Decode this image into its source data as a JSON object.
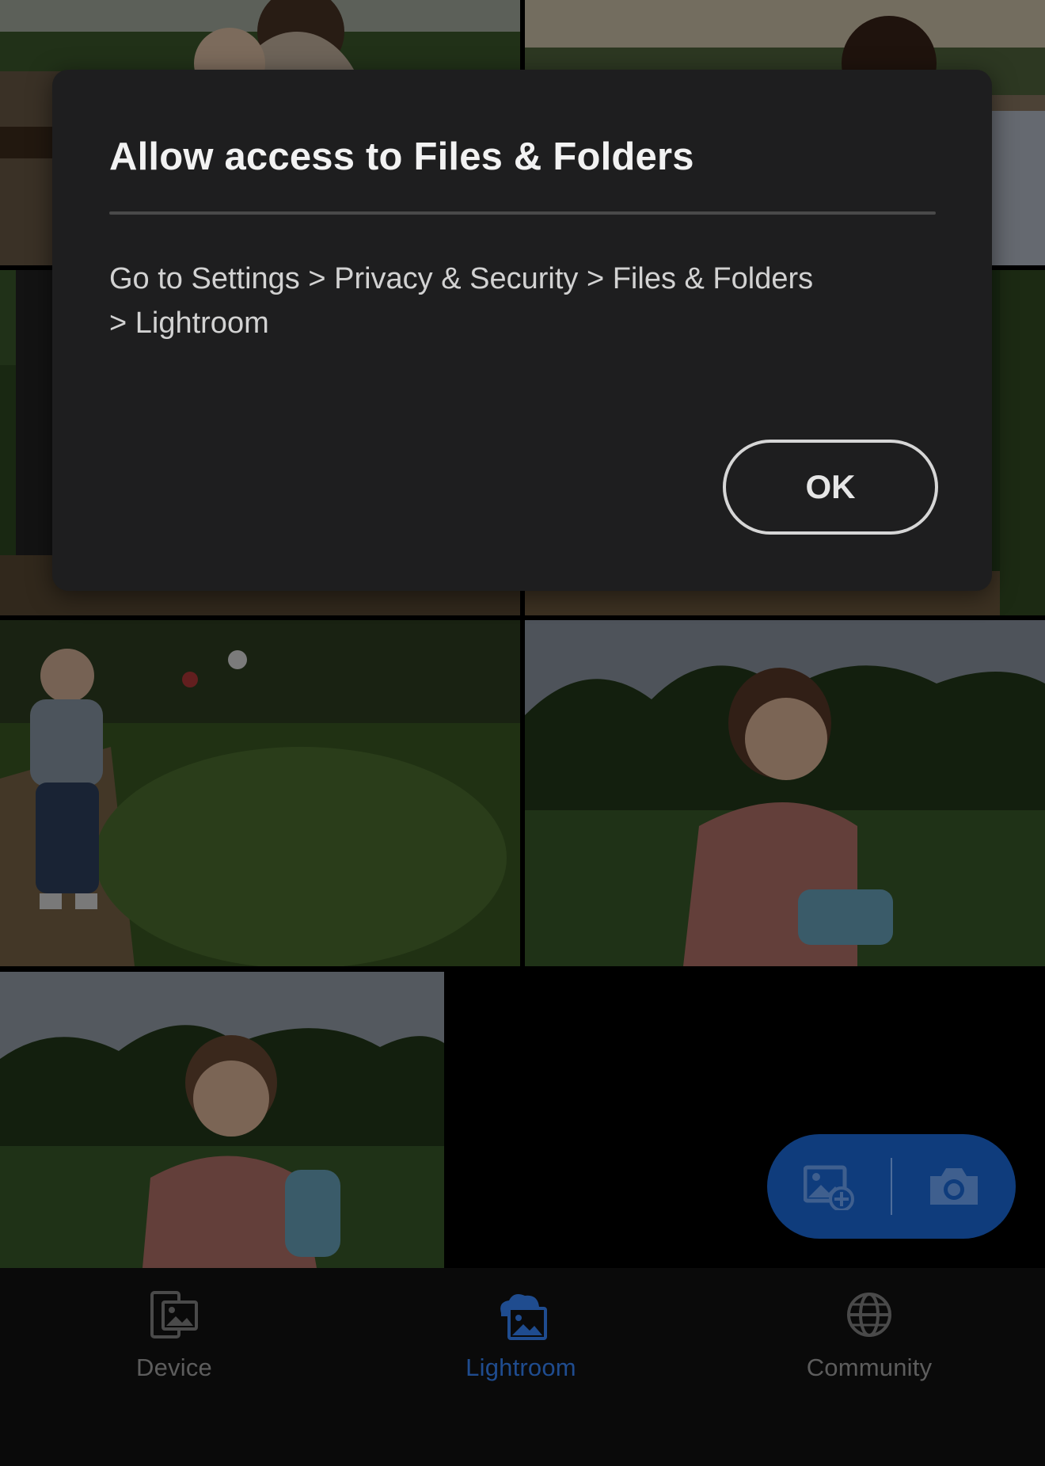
{
  "dialog": {
    "title": "Allow access to Files & Folders",
    "message_line1": "Go to Settings > Privacy & Security > Files & Folders",
    "message_line2": "> Lightroom",
    "ok_label": "OK"
  },
  "photos": {
    "count_visible": 7,
    "items": [
      {
        "subject": "woman-and-child-under-tent"
      },
      {
        "subject": "woman-under-tent"
      },
      {
        "subject": "strawberry-field-partial"
      },
      {
        "subject": "strawberry-field-partial"
      },
      {
        "subject": "toddler-boy-in-strawberry-field"
      },
      {
        "subject": "toddler-girl-holding-basket"
      },
      {
        "subject": "toddler-girl-in-field"
      }
    ]
  },
  "fab": {
    "add_photos_icon": "add-photo-icon",
    "camera_icon": "camera-icon",
    "background_color": "#0f3c7c"
  },
  "bottom_nav": {
    "items": [
      {
        "label": "Device",
        "icon": "device-icon",
        "active": false
      },
      {
        "label": "Lightroom",
        "icon": "lightroom-cloud-icon",
        "active": true
      },
      {
        "label": "Community",
        "icon": "globe-icon",
        "active": false
      }
    ],
    "active_color": "#1f4c8f",
    "inactive_color": "#5d5d5d"
  }
}
